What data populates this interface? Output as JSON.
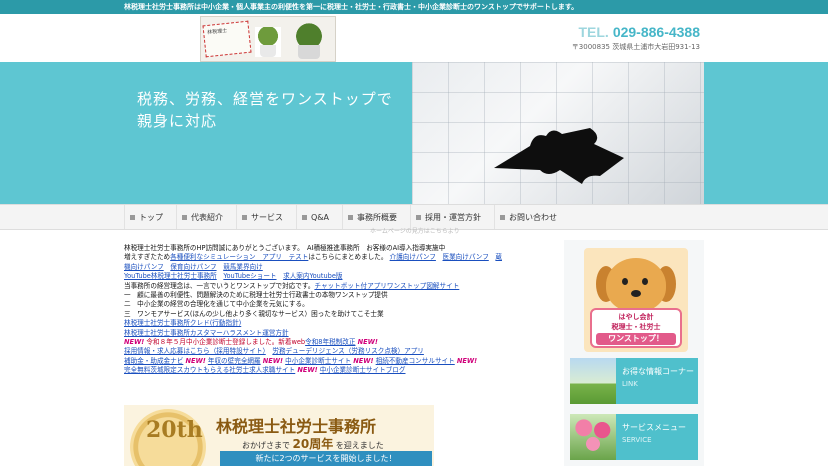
{
  "topbar": {
    "text": "林税理士社労士事務所は中小企業・個人事業主の利便性を第一に税理士・社労士・行政書士・中小企業診断士のワンストップでサポートします。"
  },
  "header": {
    "tel_label": "TEL.",
    "tel": "029-886-4388",
    "address": "〒3000835 茨城県土浦市大岩田931-13",
    "logo_text": "林税理士"
  },
  "hero": {
    "line1": "税務、労務、経営をワンストップで",
    "line2": "親身に対応"
  },
  "nav": [
    {
      "label": "トップ"
    },
    {
      "label": "代表紹介"
    },
    {
      "label": "サービス"
    },
    {
      "label": "Q&A"
    },
    {
      "label": "事務所概要"
    },
    {
      "label": "採用・運営方針"
    },
    {
      "label": "お問い合わせ"
    }
  ],
  "ghost_text": "ホームページの見方はこちらより",
  "main": {
    "intro": "林税理士社労士事務所のHP訪問誠にありがとうございます。　AI積極推進事務所　お客様のAI導入指導実施中",
    "sim_prefix": "増えすぎたため",
    "sim_link": "各種便利なシミュレーション　アプリ　テスト",
    "sim_mid": "はこちらにまとめました。",
    "pamph1": "介護向けパンフ",
    "pamph2": "医業向けパンフ",
    "pamph3": "蔵",
    "pamph4": "機向けパンフ",
    "pamph5": "保育向けパンフ",
    "pamph6": "競馬業界向け",
    "yt1": "YouTube林税理士社労士事務所",
    "yt2": "YouTubeショート",
    "yt3": "求人案内Youtube版",
    "biz_prefix": "当事務所の経営理念は、一言でいうとワンストップで対応です。",
    "biz_link": "チャットボット付アプリワンストップ図解サイト",
    "p1": "一　顧に最善の利便性、問題解決のために税理士社労士行政書士の本物ワンストップ提供",
    "p2": "二　中小企業の経営の合理化を通じて中小企業を元気にする。",
    "p3": "三　ワンモアサービス(ほんの少し他より多く親切なサービス）困ったを助けてこそ士業",
    "link_credo": "林税理士社労士事務所クレド(行動指針)",
    "link_harass": "林税理士社労士事務所カスタマーハラスメント運営方針",
    "new_label": "NEW!",
    "reg_text": "令和８年５月中小企業診断士登録しました。新着web",
    "reg_link": "令和8年税制改正",
    "rec_link": "採用情報・求人応募はこちら（採用特設サイト）",
    "labor_link": "労務デューデリジェンス（労務リスク点検）アプリ",
    "sub_link": "補助金・助成金ナビ",
    "nenshu_link": "年収の壁完全網羅",
    "shindan_link": "中小企業診断士サイト",
    "souzoku_link": "相続不動産コンサルサイト",
    "scout_link": "完全無料茨城限定スカウトもらえる社労士求人求職サイト",
    "blog_link": "中小企業診断士サイトブログ"
  },
  "banner": {
    "badge": "20th",
    "title": "林税理士社労士事務所",
    "sub_pre": "おかげさまで",
    "sub_big": "20周年",
    "sub_post": "を迎えました",
    "ribbon": "新たに2つのサービスを開始しました！"
  },
  "side": {
    "dog_line1": "はやし会計",
    "dog_line2": "税理士・社労士",
    "dog_line3": "ワンストップ！",
    "card1_title": "お得な情報コーナー",
    "card1_sub": "LINK",
    "card2_title": "サービスメニュー",
    "card2_sub": "SERVICE"
  },
  "colors": {
    "accent": "#2c9aa8",
    "hero": "#5ec6d2",
    "link": "#1a4fbf",
    "new": "#d0007a"
  }
}
